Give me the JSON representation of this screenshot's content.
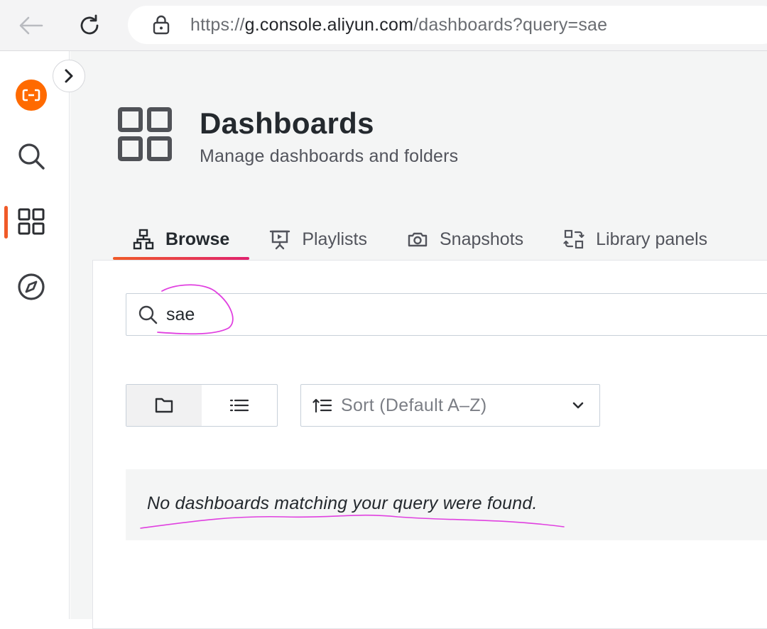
{
  "browser": {
    "url_scheme": "https://",
    "url_host": "g.console.aliyun.com",
    "url_path": "/dashboards?query=sae",
    "icons": [
      "back-arrow-icon",
      "reload-icon",
      "lock-icon"
    ]
  },
  "sidebar": {
    "items": [
      {
        "name": "aliyun-logo",
        "icon": "aliyun-logo-icon"
      },
      {
        "name": "search",
        "icon": "search-icon"
      },
      {
        "name": "dashboards",
        "icon": "grid-icon",
        "active": true
      },
      {
        "name": "explore",
        "icon": "compass-icon"
      }
    ],
    "expand_icon": "chevron-right-icon"
  },
  "header": {
    "title": "Dashboards",
    "subtitle": "Manage dashboards and folders"
  },
  "tabs": [
    {
      "label": "Browse",
      "icon": "sitemap-icon",
      "active": true
    },
    {
      "label": "Playlists",
      "icon": "presentation-icon",
      "active": false
    },
    {
      "label": "Snapshots",
      "icon": "camera-icon",
      "active": false
    },
    {
      "label": "Library panels",
      "icon": "library-panels-icon",
      "active": false
    }
  ],
  "search": {
    "value": "sae"
  },
  "view_toggle": {
    "folder_view": "folder-icon",
    "list_view": "list-icon",
    "selected": "folder_view"
  },
  "sort": {
    "label": "Sort (Default A–Z)"
  },
  "empty_state": {
    "message": "No dashboards matching your query were found."
  },
  "colors": {
    "accent": "#f05a28",
    "logo": "#ff6a00",
    "annotation": "#e040e0"
  }
}
